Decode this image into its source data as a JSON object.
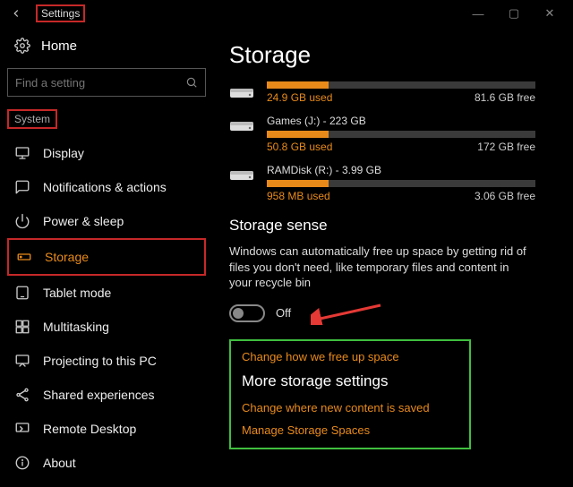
{
  "window": {
    "title": "Settings",
    "controls": {
      "minimize": "—",
      "maximize": "▢",
      "close": "✕"
    }
  },
  "sidebar": {
    "home_label": "Home",
    "search_placeholder": "Find a setting",
    "section_label": "System",
    "items": [
      {
        "label": "Display",
        "icon": "display"
      },
      {
        "label": "Notifications & actions",
        "icon": "chat"
      },
      {
        "label": "Power & sleep",
        "icon": "power"
      },
      {
        "label": "Storage",
        "icon": "storage",
        "selected": true
      },
      {
        "label": "Tablet mode",
        "icon": "tablet"
      },
      {
        "label": "Multitasking",
        "icon": "multitask"
      },
      {
        "label": "Projecting to this PC",
        "icon": "project"
      },
      {
        "label": "Shared experiences",
        "icon": "share"
      },
      {
        "label": "Remote Desktop",
        "icon": "remote"
      },
      {
        "label": "About",
        "icon": "info"
      }
    ]
  },
  "content": {
    "page_title": "Storage",
    "drives": [
      {
        "title": "",
        "used": "24.9 GB used",
        "free": "81.6 GB free",
        "fill_pct": 23
      },
      {
        "title": "Games (J:) - 223 GB",
        "used": "50.8 GB used",
        "free": "172 GB free",
        "fill_pct": 23
      },
      {
        "title": "RAMDisk (R:) - 3.99 GB",
        "used": "958 MB used",
        "free": "3.06 GB free",
        "fill_pct": 23
      }
    ],
    "sense": {
      "heading": "Storage sense",
      "description": "Windows can automatically free up space by getting rid of files you don't need, like temporary files and content in your recycle bin",
      "toggle_state": "Off"
    },
    "links": {
      "change_free": "Change how we free up space",
      "more_heading": "More storage settings",
      "change_where": "Change where new content is saved",
      "manage_spaces": "Manage Storage Spaces"
    }
  }
}
